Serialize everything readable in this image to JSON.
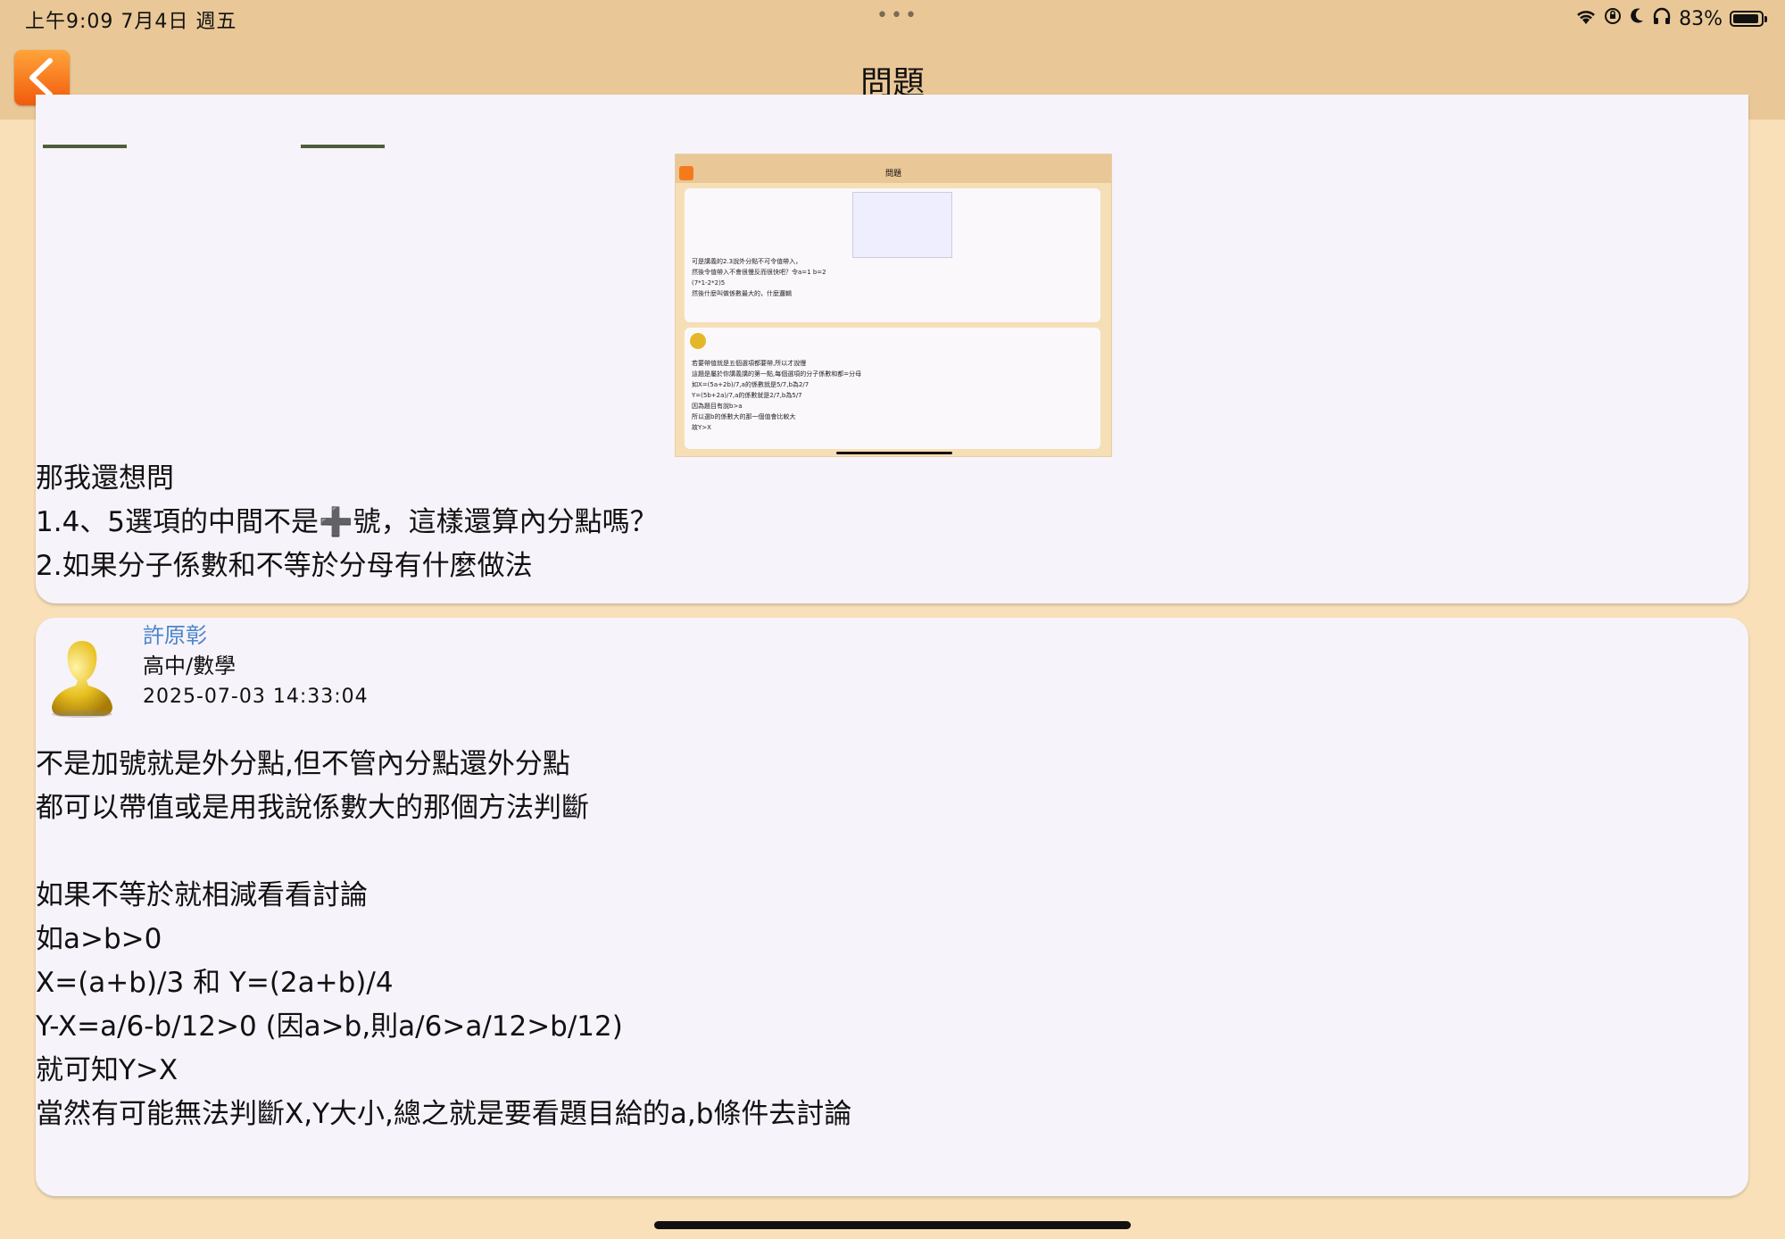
{
  "status": {
    "time": "上午9:09   7月4日 週五",
    "dots": "•••",
    "battery": "83%"
  },
  "nav": {
    "title": "問題"
  },
  "post1": {
    "embedded_screenshot": {
      "title": "問題",
      "lines_a": [
        "可是講義的2.3說外分點不可令值帶入，",
        "然後令值帶入不會很慢反而很快吧？令a=1 b=2",
        "(7*1-2*2)5",
        "然後什麼叫做係數最大的，什麼邏輯"
      ],
      "lines_b": [
        "若要帶值就是五個選項都要帶,所以才說慢",
        "這題是屬於你講義講的第一點,每個選項的分子係數和都=分母",
        "如X=(5a+2b)/7,a的係數就是5/7,b為2/7",
        "Y=(5b+2a)/7,a的係數就是2/7,b為5/7",
        "因為題目有說b>a",
        "所以選b的係數大的那一個值會比較大",
        "故Y>X"
      ]
    },
    "lines": [
      "那我還想問",
      "1.4、5選項的中間不是➕號，這樣還算內分點嗎？",
      "2.如果分子係數和不等於分母有什麼做法"
    ]
  },
  "post2": {
    "author": "許原彰",
    "role": "高中/數學",
    "time": "2025-07-03 14:33:04",
    "lines": [
      "不是加號就是外分點,但不管內分點還外分點",
      "都可以帶值或是用我說係數大的那個方法判斷",
      "",
      "如果不等於就相減看看討論",
      "如a>b>0",
      "X=(a+b)/3 和  Y=(2a+b)/4",
      "Y-X=a/6-b/12>0 (因a>b,則a/6>a/12>b/12)",
      "就可知Y>X",
      "當然有可能無法判斷X,Y大小,總之就是要看題目給的a,b條件去討論"
    ]
  }
}
